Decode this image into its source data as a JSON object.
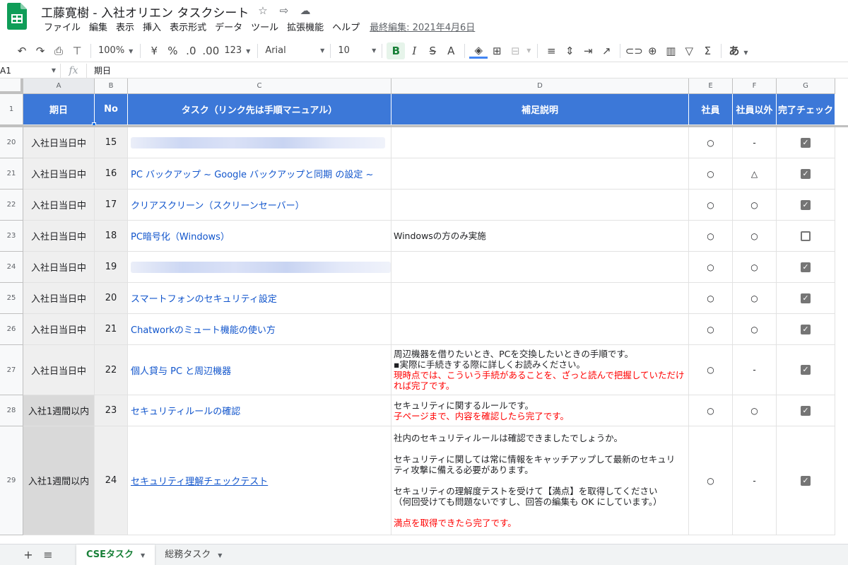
{
  "app": {
    "title": "工藤寛樹 - 入社オリエン タスクシート",
    "colors": {
      "brand_green": "#0f9d58",
      "header_blue": "#3c78d8",
      "link_blue": "#1155cc",
      "red_text": "#ff0000"
    }
  },
  "menu": {
    "items": [
      "ファイル",
      "編集",
      "表示",
      "挿入",
      "表示形式",
      "データ",
      "ツール",
      "拡張機能",
      "ヘルプ"
    ],
    "last_edit": "最終編集: 2021年4月6日"
  },
  "toolbar": {
    "zoom": "100%",
    "currency": "¥",
    "percent": "%",
    "dec_decrease": ".0",
    "dec_increase": ".00",
    "number_format": "123",
    "font": "Arial",
    "font_size": "10",
    "bold": "B",
    "text_color": "A",
    "input_tool": "あ"
  },
  "formula_bar": {
    "cell_ref": "A1",
    "fx": "fx",
    "content": "期日"
  },
  "columns": [
    "A",
    "B",
    "C",
    "D",
    "E",
    "F",
    "G"
  ],
  "header": {
    "row_number": "1",
    "date": "期日",
    "no": "No",
    "task": "タスク（リンク先は手順マニュアル）",
    "notes": "補足説明",
    "employee": "社員",
    "non_employee": "社員以外",
    "done": "完了チェック"
  },
  "rows": [
    {
      "row": "20",
      "date": "入社日当日中",
      "no": "15",
      "task": "",
      "notes": [],
      "employee": "○",
      "non_employee": "-",
      "checked": true
    },
    {
      "row": "21",
      "date": "入社日当日中",
      "no": "16",
      "task": "PC バックアップ ~ Google バックアップと同期 の設定 ~",
      "notes": [],
      "employee": "○",
      "non_employee": "△",
      "checked": true
    },
    {
      "row": "22",
      "date": "入社日当日中",
      "no": "17",
      "task": "クリアスクリーン（スクリーンセーバー）",
      "notes": [],
      "employee": "○",
      "non_employee": "○",
      "checked": true
    },
    {
      "row": "23",
      "date": "入社日当日中",
      "no": "18",
      "task": "PC暗号化（Windows）",
      "notes": [
        {
          "text": "Windowsの方のみ実施",
          "red": false
        }
      ],
      "employee": "○",
      "non_employee": "○",
      "checked": false
    },
    {
      "row": "24",
      "date": "入社日当日中",
      "no": "19",
      "task": "",
      "notes": [],
      "employee": "○",
      "non_employee": "○",
      "checked": true
    },
    {
      "row": "25",
      "date": "入社日当日中",
      "no": "20",
      "task": "スマートフォンのセキュリティ設定",
      "notes": [],
      "employee": "○",
      "non_employee": "○",
      "checked": true
    },
    {
      "row": "26",
      "date": "入社日当日中",
      "no": "21",
      "task": "Chatworkのミュート機能の使い方",
      "notes": [],
      "employee": "○",
      "non_employee": "○",
      "checked": true
    },
    {
      "row": "27",
      "date": "入社日当日中",
      "no": "22",
      "task": "個人貸与 PC と周辺機器",
      "notes": [
        {
          "text": "周辺機器を借りたいとき、PCを交換したいときの手順です。",
          "red": false
        },
        {
          "text": "▪実際に手続きする際に詳しくお読みください。",
          "red": false
        },
        {
          "text": "現時点では、こういう手続があることを、ざっと読んで把握していただけ",
          "red": true
        },
        {
          "text": "れば完了です。",
          "red": true
        }
      ],
      "employee": "○",
      "non_employee": "-",
      "checked": true
    },
    {
      "row": "28",
      "date": "入社1週間以内",
      "no": "23",
      "task": "セキュリティルールの確認",
      "notes": [
        {
          "text": "セキュリティに関するルールです。",
          "red": false
        },
        {
          "text": "子ページまで、内容を確認したら完了です。",
          "red": true
        }
      ],
      "employee": "○",
      "non_employee": "○",
      "checked": true
    },
    {
      "row": "29",
      "date": "入社1週間以内",
      "no": "24",
      "task": "セキュリティ理解チェックテスト",
      "notes": [
        {
          "text": "社内のセキュリティルールは確認できましたでしょうか。",
          "red": false
        },
        {
          "text": "",
          "red": false
        },
        {
          "text": "セキュリティに関しては常に情報をキャッチアップして最新のセキュリ",
          "red": false
        },
        {
          "text": "ティ攻撃に備える必要があります。",
          "red": false
        },
        {
          "text": "",
          "red": false
        },
        {
          "text": "セキュリティの理解度テストを受けて【満点】を取得してください",
          "red": false
        },
        {
          "text": "（何回受けても問題ないですし、回答の編集も OK にしています。）",
          "red": false
        },
        {
          "text": "",
          "red": false
        },
        {
          "text": "満点を取得できたら完了です。",
          "red": true
        }
      ],
      "employee": "○",
      "non_employee": "-",
      "checked": true
    }
  ],
  "sheets": {
    "add": "+",
    "all": "≡",
    "tabs": [
      {
        "label": "CSEタスク",
        "active": true
      },
      {
        "label": "総務タスク",
        "active": false
      }
    ]
  }
}
